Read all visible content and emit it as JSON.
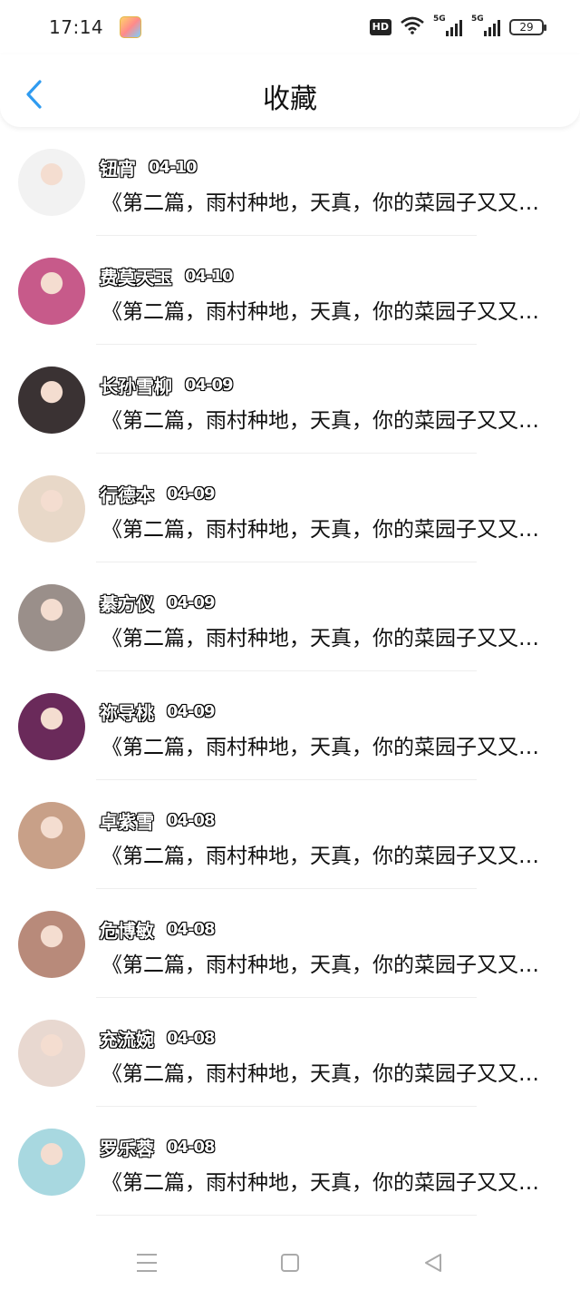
{
  "status_bar": {
    "time": "17:14",
    "hd_label": "HD",
    "network1": "5G",
    "network2": "5G",
    "battery": "29"
  },
  "header": {
    "title": "收藏"
  },
  "favorites": [
    {
      "name": "钮宵",
      "date": "04-10",
      "preview": "《第二篇，雨村种地，天真，你的菜园子又又又又长草了》",
      "avatar_color": "#f2f2f2"
    },
    {
      "name": "费莫天玉",
      "date": "04-10",
      "preview": "《第二篇，雨村种地，天真，你的菜园子又又又又长草了》",
      "avatar_color": "#c75a8a"
    },
    {
      "name": "长孙雪柳",
      "date": "04-09",
      "preview": "《第二篇，雨村种地，天真，你的菜园子又又又又长草了》",
      "avatar_color": "#3a3233"
    },
    {
      "name": "行德本",
      "date": "04-09",
      "preview": "《第二篇，雨村种地，天真，你的菜园子又又又又长草了》",
      "avatar_color": "#e8d8c8"
    },
    {
      "name": "綦方仪",
      "date": "04-09",
      "preview": "《第二篇，雨村种地，天真，你的菜园子又又又又长草了》",
      "avatar_color": "#9a8f8a"
    },
    {
      "name": "祢导桃",
      "date": "04-09",
      "preview": "《第二篇，雨村种地，天真，你的菜园子又又又又长草了》",
      "avatar_color": "#6a2a5a"
    },
    {
      "name": "卓紫雪",
      "date": "04-08",
      "preview": "《第二篇，雨村种地，天真，你的菜园子又又又又长草了》",
      "avatar_color": "#c8a088"
    },
    {
      "name": "危博敏",
      "date": "04-08",
      "preview": "《第二篇，雨村种地，天真，你的菜园子又又又又长草了》",
      "avatar_color": "#b88a7a"
    },
    {
      "name": "充流婉",
      "date": "04-08",
      "preview": "《第二篇，雨村种地，天真，你的菜园子又又又又长草了》",
      "avatar_color": "#e8d8d0"
    },
    {
      "name": "罗乐蓉",
      "date": "04-08",
      "preview": "《第二篇，雨村种地，天真，你的菜园子又又又又长草了》",
      "avatar_color": "#a8d8e0"
    }
  ]
}
